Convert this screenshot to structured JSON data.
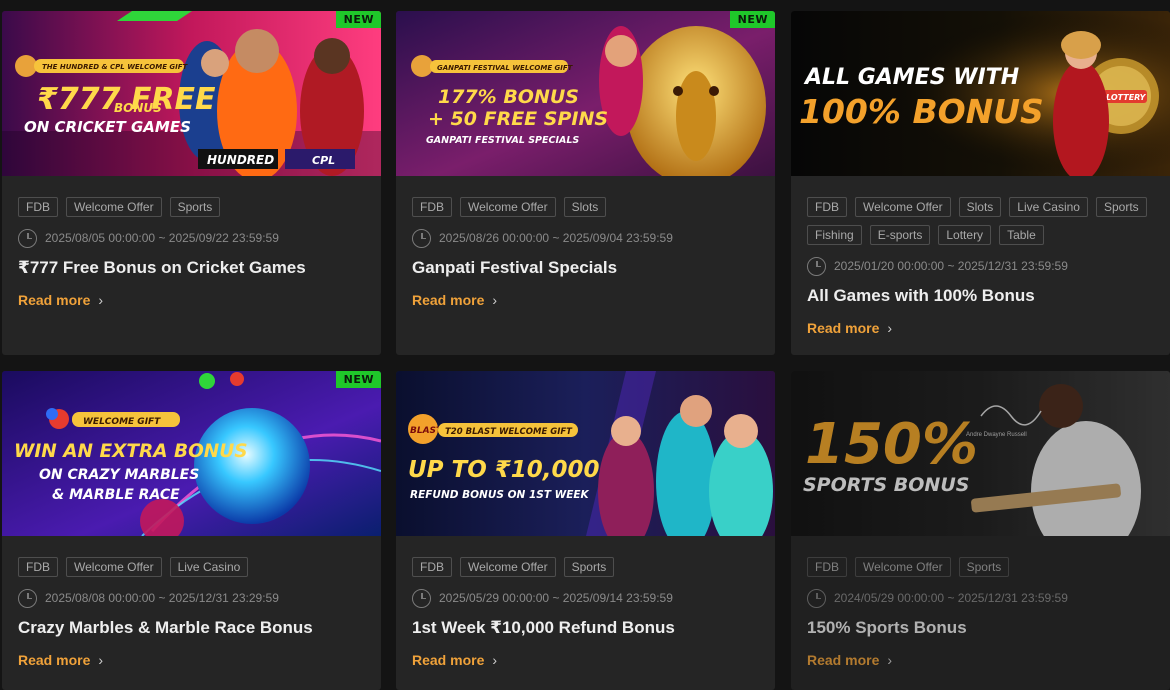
{
  "labels": {
    "new": "NEW",
    "read_more": "Read more"
  },
  "cards": [
    {
      "title": "₹777 Free Bonus on Cricket Games",
      "date": "2025/08/05 00:00:00 ~ 2025/09/22 23:59:59",
      "tags": [
        "FDB",
        "Welcome Offer",
        "Sports"
      ],
      "banner": {
        "kicker": "THE HUNDRED & CPL WELCOME GIFT",
        "line1": "₹777 FREE",
        "line1b": "BONUS",
        "line2": "ON CRICKET GAMES",
        "logo1": "HUNDRED",
        "logo2": "CPL"
      }
    },
    {
      "title": "Ganpati Festival Specials",
      "date": "2025/08/26 00:00:00 ~ 2025/09/04 23:59:59",
      "tags": [
        "FDB",
        "Welcome Offer",
        "Slots"
      ],
      "banner": {
        "kicker": "GANPATI FESTIVAL WELCOME GIFT",
        "line1": "177% BONUS",
        "line2": "+ 50 FREE SPINS",
        "line3": "GANPATI FESTIVAL SPECIALS"
      }
    },
    {
      "title": "All Games with 100% Bonus",
      "date": "2025/01/20 00:00:00 ~ 2025/12/31 23:59:59",
      "tags": [
        "FDB",
        "Welcome Offer",
        "Slots",
        "Live Casino",
        "Sports",
        "Fishing",
        "E-sports",
        "Lottery",
        "Table"
      ],
      "banner": {
        "line1": "ALL GAMES WITH",
        "line2": "100% BONUS",
        "badge": "LOTTERY"
      }
    },
    {
      "title": "Crazy Marbles & Marble Race Bonus",
      "date": "2025/08/08 00:00:00 ~ 2025/12/31 23:29:59",
      "tags": [
        "FDB",
        "Welcome Offer",
        "Live Casino"
      ],
      "banner": {
        "kicker": "WELCOME GIFT",
        "line1": "WIN AN EXTRA BONUS",
        "line2": "ON CRAZY MARBLES",
        "line3": "& MARBLE RACE"
      }
    },
    {
      "title": "1st Week ₹10,000 Refund Bonus",
      "date": "2025/05/29 00:00:00 ~ 2025/09/14 23:59:59",
      "tags": [
        "FDB",
        "Welcome Offer",
        "Sports"
      ],
      "banner": {
        "logo": "BLAST!",
        "kicker": "T20 BLAST WELCOME GIFT",
        "line1": "UP TO ₹10,000",
        "line2": "REFUND BONUS ON 1ST WEEK"
      }
    },
    {
      "title": "150% Sports Bonus",
      "date": "2024/05/29 00:00:00 ~ 2025/12/31 23:59:59",
      "tags": [
        "FDB",
        "Welcome Offer",
        "Sports"
      ],
      "banner": {
        "line1": "150%",
        "line2": "SPORTS BONUS",
        "caption": "Andre Dwayne Russell"
      }
    }
  ],
  "colors": {
    "accent": "#f0a23a",
    "new_badge": "#1fc82a",
    "card_bg": "#252525",
    "page_bg": "#141414"
  }
}
